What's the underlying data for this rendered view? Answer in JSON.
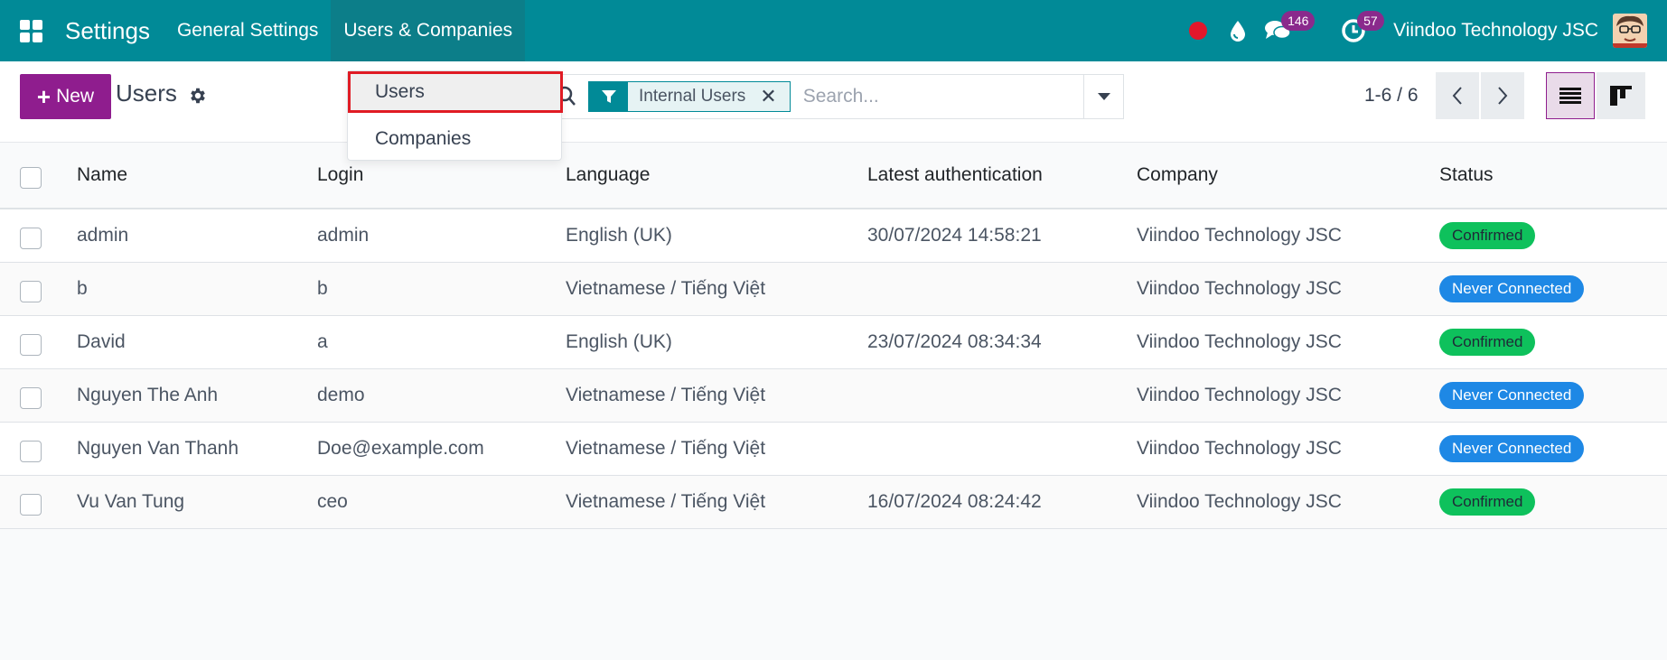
{
  "navbar": {
    "app_title": "Settings",
    "menus": [
      "General Settings",
      "Users & Companies"
    ],
    "messages_count": "146",
    "activities_count": "57",
    "company": "Viindoo Technology JSC"
  },
  "control_panel": {
    "new_label": "New",
    "title": "Users",
    "facet_label": "Internal Users",
    "search_placeholder": "Search...",
    "pager": "1-6 / 6"
  },
  "dropdown": {
    "items": [
      "Users",
      "Companies"
    ]
  },
  "table": {
    "headers": {
      "name": "Name",
      "login": "Login",
      "language": "Language",
      "latest_auth": "Latest authentication",
      "company": "Company",
      "status": "Status"
    },
    "rows": [
      {
        "name": "admin",
        "login": "admin",
        "language": "English (UK)",
        "latest_auth": "30/07/2024 14:58:21",
        "company": "Viindoo Technology JSC",
        "status": "Confirmed"
      },
      {
        "name": "b",
        "login": "b",
        "language": "Vietnamese / Tiếng Việt",
        "latest_auth": "",
        "company": "Viindoo Technology JSC",
        "status": "Never Connected"
      },
      {
        "name": "David",
        "login": "a",
        "language": "English (UK)",
        "latest_auth": "23/07/2024 08:34:34",
        "company": "Viindoo Technology JSC",
        "status": "Confirmed"
      },
      {
        "name": "Nguyen The Anh",
        "login": "demo",
        "language": "Vietnamese / Tiếng Việt",
        "latest_auth": "",
        "company": "Viindoo Technology JSC",
        "status": "Never Connected"
      },
      {
        "name": "Nguyen Van Thanh",
        "login": "Doe@example.com",
        "language": "Vietnamese / Tiếng Việt",
        "latest_auth": "",
        "company": "Viindoo Technology JSC",
        "status": "Never Connected"
      },
      {
        "name": "Vu Van Tung",
        "login": "ceo",
        "language": "Vietnamese / Tiếng Việt",
        "latest_auth": "16/07/2024 08:24:42",
        "company": "Viindoo Technology JSC",
        "status": "Confirmed"
      }
    ]
  },
  "colors": {
    "navbar": "#018a97",
    "primary": "#8f1d8e",
    "confirmed": "#0ec15c",
    "never_connected": "#1e88e5",
    "highlight_border": "#e01b24"
  }
}
